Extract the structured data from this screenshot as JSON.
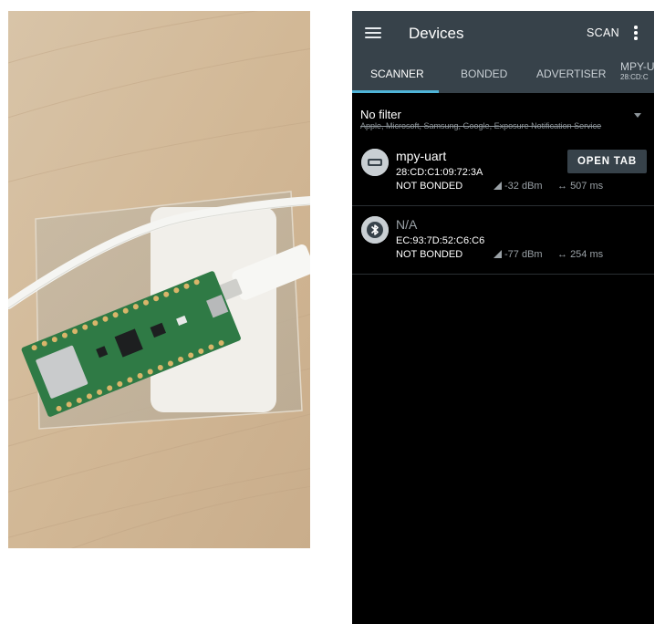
{
  "app": {
    "title": "Devices",
    "scan_label": "SCAN"
  },
  "tabs": [
    {
      "label": "SCANNER",
      "active": true
    },
    {
      "label": "BONDED",
      "active": false
    },
    {
      "label": "ADVERTISER",
      "active": false
    },
    {
      "label": "MPY-U",
      "sub": "28:CD:C",
      "active": false
    }
  ],
  "filter": {
    "title": "No filter",
    "excluded": "Apple, Microsoft, Samsung, Google, Exposure Notification Service"
  },
  "devices": [
    {
      "name": "mpy-uart",
      "address": "28:CD:C1:09:72:3A",
      "bond_state": "NOT BONDED",
      "rssi": "-32 dBm",
      "interval": "507 ms",
      "icon": "usb-serial-icon",
      "action_label": "OPEN TAB"
    },
    {
      "name": "N/A",
      "address": "EC:93:7D:52:C6:C6",
      "bond_state": "NOT BONDED",
      "rssi": "-77 dBm",
      "interval": "254 ms",
      "icon": "bluetooth-icon"
    }
  ],
  "colors": {
    "app_bar": "#37424a",
    "tab_indicator": "#4fb4d8",
    "background": "#000000",
    "photo_wood": "#d9c3a5",
    "pcb_green": "#2f7a45"
  }
}
